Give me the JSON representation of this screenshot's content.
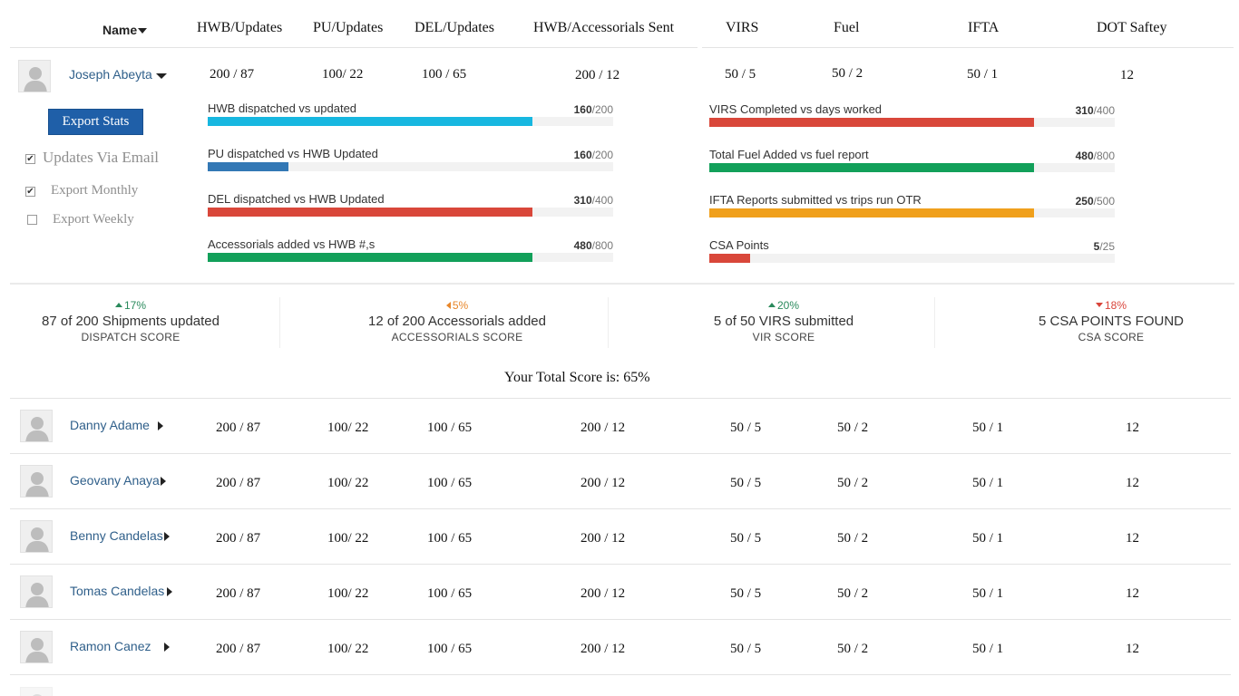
{
  "header": {
    "name": "Name",
    "hwb": "HWB/Updates",
    "pu": "PU/Updates",
    "del": "DEL/Updates",
    "acc": "HWB/Accessorials Sent",
    "virs": "VIRS",
    "fuel": "Fuel",
    "ifta": "IFTA",
    "dot": "DOT Saftey"
  },
  "expanded": {
    "name": "Joseph Abeyta",
    "hwb": "200 / 87",
    "pu": "100/ 22",
    "del": "100 / 65",
    "acc": "200 / 12",
    "virs": "50 / 5",
    "fuel": "50 / 2",
    "ifta": "50 / 1",
    "dot": "12",
    "export_button": "Export Stats",
    "options": [
      {
        "label": "Updates Via Email",
        "checked": true
      },
      {
        "label": "Export Monthly",
        "checked": true
      },
      {
        "label": "Export Weekly",
        "checked": false
      }
    ],
    "left_progress": [
      {
        "label": "HWB dispatched vs updated",
        "value": "160",
        "total": "/200",
        "fraction": 0.8,
        "color": "#17b7e0"
      },
      {
        "label": "PU dispatched vs HWB Updated",
        "value": "160",
        "total": "/200",
        "fraction": 0.2,
        "color": "#3378b5"
      },
      {
        "label": "DEL dispatched vs HWB Updated",
        "value": "310",
        "total": "/400",
        "fraction": 0.8,
        "color": "#d9473a"
      },
      {
        "label": "Accessorials added vs HWB #,s",
        "value": "480",
        "total": "/800",
        "fraction": 0.8,
        "color": "#12a05a"
      }
    ],
    "right_progress": [
      {
        "label": "VIRS Completed vs days worked",
        "value": "310",
        "total": "/400",
        "fraction": 0.8,
        "color": "#d9473a"
      },
      {
        "label": "Total Fuel Added vs fuel report",
        "value": "480",
        "total": "/800",
        "fraction": 0.8,
        "color": "#12a05a"
      },
      {
        "label": "IFTA Reports submitted vs trips run OTR",
        "value": "250",
        "total": "/500",
        "fraction": 0.8,
        "color": "#f0a01c"
      },
      {
        "label": "CSA Points",
        "value": "5",
        "total": "/25",
        "fraction": 0.1,
        "color": "#d9473a"
      }
    ]
  },
  "scores": [
    {
      "pct": "17%",
      "trend": "up",
      "color": "#2a8a5c",
      "headline": "87 of 200 Shipments updated",
      "caption": "DISPATCH SCORE"
    },
    {
      "pct": "5%",
      "trend": "left",
      "color": "#e8872b",
      "headline": "12 of 200 Accessorials added",
      "caption": "ACCESSORIALS SCORE"
    },
    {
      "pct": "20%",
      "trend": "up",
      "color": "#2a8a5c",
      "headline": "5 of 50 VIRS submitted",
      "caption": "VIR SCORE"
    },
    {
      "pct": "18%",
      "trend": "down",
      "color": "#d9443a",
      "headline": "5 CSA POINTS FOUND",
      "caption": "CSA SCORE"
    }
  ],
  "total_score": "Your Total Score is: 65%",
  "drivers": [
    {
      "name": "Danny Adame",
      "hwb": "200 / 87",
      "pu": "100/ 22",
      "del": "100 / 65",
      "acc": "200 / 12",
      "virs": "50 / 5",
      "fuel": "50 / 2",
      "ifta": "50 / 1",
      "dot": "12"
    },
    {
      "name": "Geovany Anaya",
      "hwb": "200 / 87",
      "pu": "100/ 22",
      "del": "100 / 65",
      "acc": "200 / 12",
      "virs": "50 / 5",
      "fuel": "50 / 2",
      "ifta": "50 / 1",
      "dot": "12"
    },
    {
      "name": "Benny Candelas",
      "hwb": "200 / 87",
      "pu": "100/ 22",
      "del": "100 / 65",
      "acc": "200 / 12",
      "virs": "50 / 5",
      "fuel": "50 / 2",
      "ifta": "50 / 1",
      "dot": "12"
    },
    {
      "name": "Tomas Candelas",
      "hwb": "200 / 87",
      "pu": "100/ 22",
      "del": "100 / 65",
      "acc": "200 / 12",
      "virs": "50 / 5",
      "fuel": "50 / 2",
      "ifta": "50 / 1",
      "dot": "12"
    },
    {
      "name": "Ramon Canez",
      "hwb": "200 / 87",
      "pu": "100/ 22",
      "del": "100 / 65",
      "acc": "200 / 12",
      "virs": "50 / 5",
      "fuel": "50 / 2",
      "ifta": "50 / 1",
      "dot": "12"
    }
  ]
}
